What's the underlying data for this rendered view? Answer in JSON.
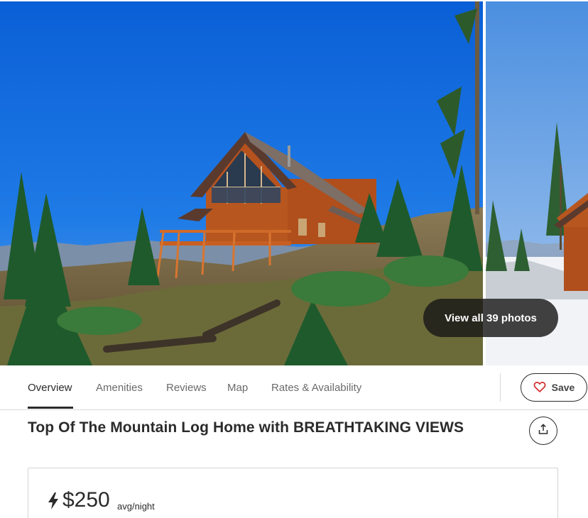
{
  "gallery": {
    "view_all_label": "View all 39 photos"
  },
  "tabs": [
    {
      "label": "Overview",
      "active": true
    },
    {
      "label": "Amenities",
      "active": false
    },
    {
      "label": "Reviews",
      "active": false
    },
    {
      "label": "Map",
      "active": false
    },
    {
      "label": "Rates & Availability",
      "active": false
    }
  ],
  "save": {
    "label": "Save",
    "icon": "heart-icon",
    "icon_color": "#d32f2f"
  },
  "listing": {
    "title": "Top Of The Mountain Log Home with BREATHTAKING VIEWS",
    "share_icon": "share-icon"
  },
  "pricing": {
    "instant_book_icon": "lightning-bolt-icon",
    "price": "$250",
    "unit": "avg/night"
  },
  "colors": {
    "sky": "#0d63d8",
    "text": "#2b2b2b",
    "muted": "#6b6b6b",
    "border": "#d9d9d9"
  }
}
